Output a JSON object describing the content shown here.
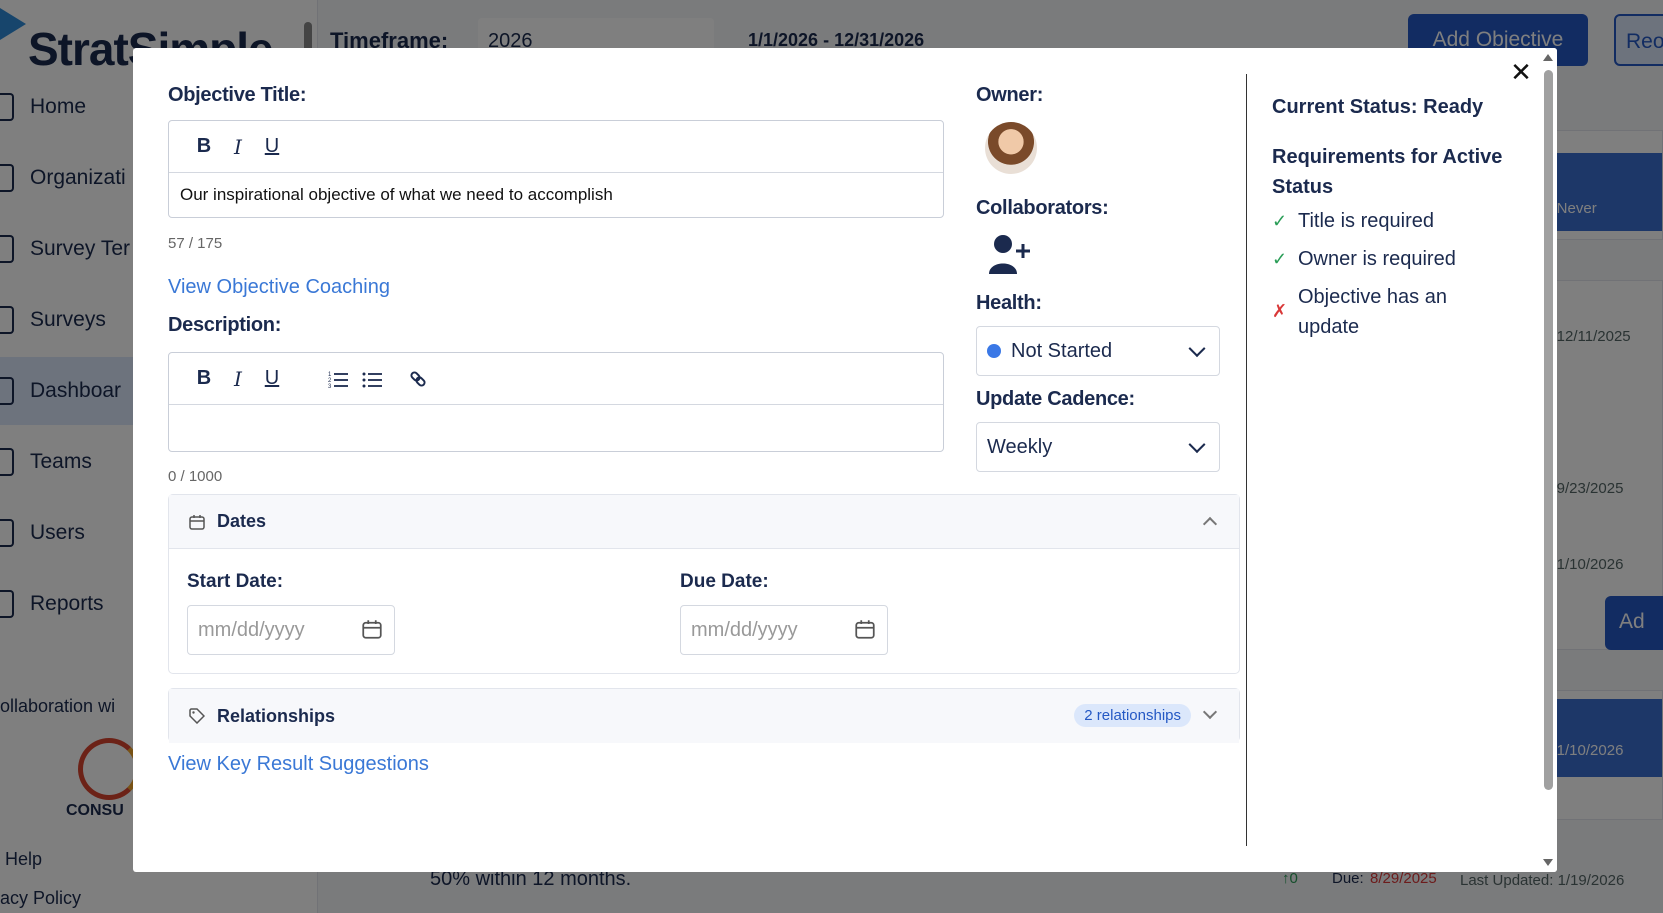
{
  "app": {
    "logo_text": "StratSimple"
  },
  "sidebar": {
    "items": [
      {
        "label": "Home"
      },
      {
        "label": "Organizati"
      },
      {
        "label": "Survey Ter"
      },
      {
        "label": "Surveys"
      },
      {
        "label": "Dashboar"
      },
      {
        "label": "Teams"
      },
      {
        "label": "Users"
      },
      {
        "label": "Reports"
      }
    ],
    "active_index": 4,
    "collab_text": "ollaboration wi",
    "consult_text": "CONSU",
    "help": "Help",
    "privacy": "acy Policy"
  },
  "topbar": {
    "timeframe_label": "Timeframe:",
    "timeframe_value": "2026",
    "range": "1/1/2026 - 12/31/2026",
    "add_objective": "Add Objective",
    "reorder": "Reo"
  },
  "background": {
    "updated": [
      "d: Never",
      "d: 12/11/2025",
      "d: 9/23/2025",
      "d: 1/10/2026",
      "d: 1/10/2026"
    ],
    "add_btn": "Ad",
    "bottom_text": "50% within 12 months.",
    "bottom_delta": "↑0",
    "bottom_due_label": "Due:",
    "bottom_due_date": "8/29/2025",
    "bottom_last_updated": "Last Updated: 1/19/2026"
  },
  "modal": {
    "title_label": "Objective Title:",
    "title_value": "Our inspirational objective of what we need to accomplish",
    "title_counter": "57 / 175",
    "coaching_link": "View Objective Coaching",
    "description_label": "Description:",
    "description_value": "",
    "description_counter": "0 / 1000",
    "toolbar": {
      "bold": "B",
      "italic": "I",
      "underline": "U"
    },
    "owner_label": "Owner:",
    "collaborators_label": "Collaborators:",
    "health_label": "Health:",
    "health_value": "Not Started",
    "cadence_label": "Update Cadence:",
    "cadence_value": "Weekly",
    "dates_section": "Dates",
    "start_date_label": "Start Date:",
    "start_date_placeholder": "mm/dd/yyyy",
    "due_date_label": "Due Date:",
    "due_date_placeholder": "mm/dd/yyyy",
    "relationships_section": "Relationships",
    "relationships_badge": "2 relationships",
    "kr_suggestions_link": "View Key Result Suggestions",
    "close": "✕",
    "status_title": "Current Status: Ready",
    "requirements_title": "Requirements for Active Status",
    "requirements": [
      {
        "mark": "✓",
        "text": "Title is required",
        "met": true
      },
      {
        "mark": "✓",
        "text": "Owner is required",
        "met": true
      },
      {
        "mark": "✗",
        "text": "Objective has an update",
        "met": false
      }
    ]
  },
  "colors": {
    "accent": "#2458c4",
    "link": "#3a78d6",
    "ok": "#2a9d57",
    "bad": "#d93838",
    "health_dot": "#3a78e6"
  }
}
